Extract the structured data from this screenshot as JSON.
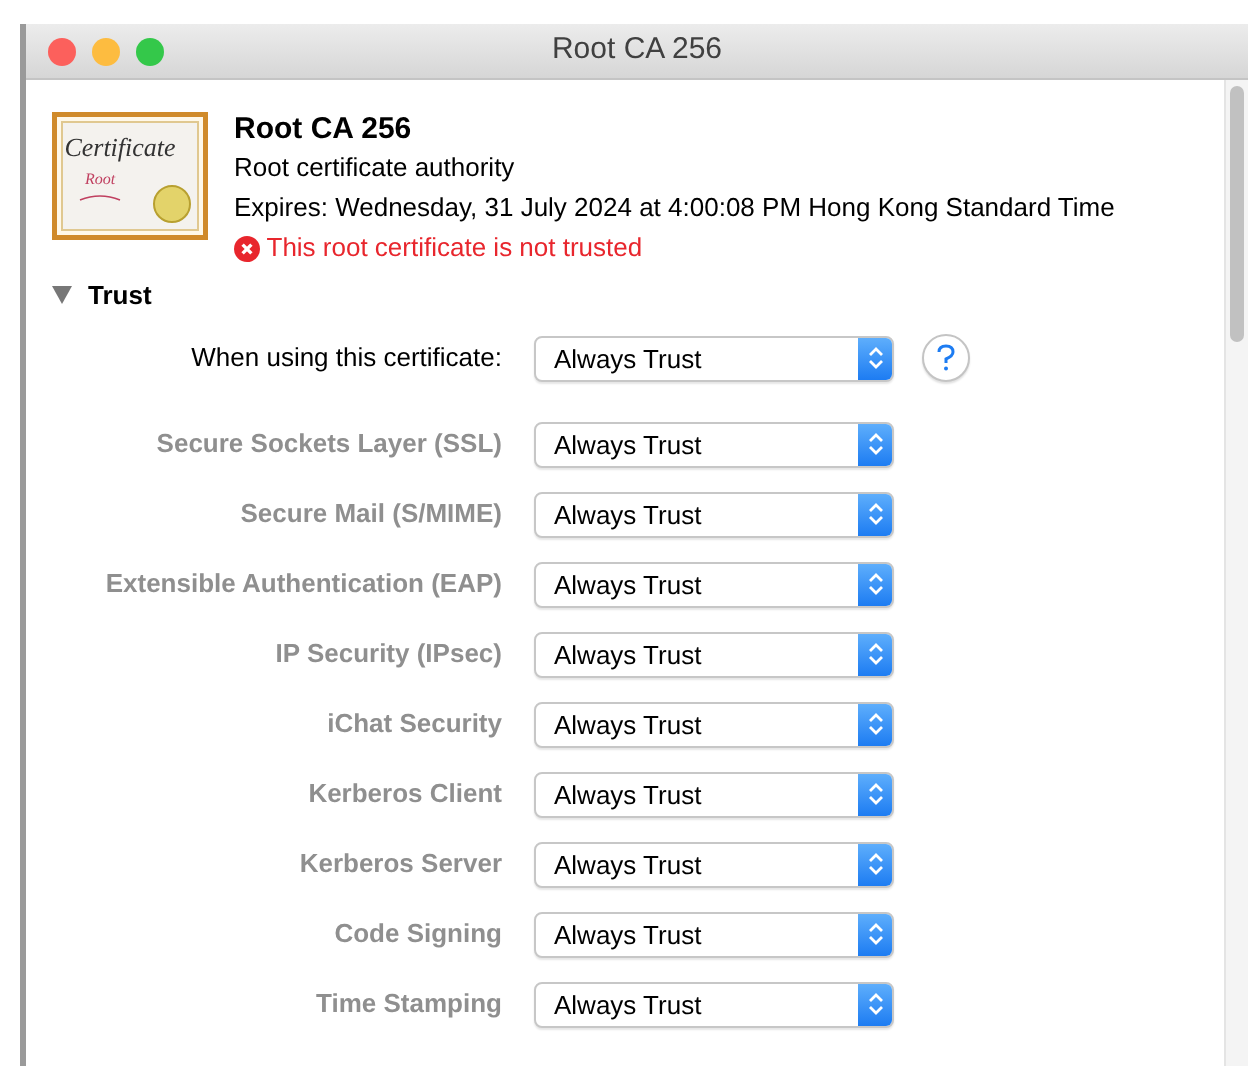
{
  "window": {
    "title": "Root CA 256"
  },
  "certificate": {
    "icon_title": "Certificate",
    "icon_subtitle": "Root",
    "name": "Root CA 256",
    "type": "Root certificate authority",
    "expires": "Expires: Wednesday, 31 July 2024 at 4:00:08 PM Hong Kong Standard Time",
    "status": "This root certificate is not trusted",
    "trusted": false
  },
  "trust": {
    "title": "Trust",
    "expanded": true,
    "main": {
      "label": "When using this certificate:",
      "value": "Always Trust"
    },
    "rows": [
      {
        "label": "Secure Sockets Layer (SSL)",
        "value": "Always Trust",
        "disabled": true
      },
      {
        "label": "Secure Mail (S/MIME)",
        "value": "Always Trust",
        "disabled": true
      },
      {
        "label": "Extensible Authentication (EAP)",
        "value": "Always Trust",
        "disabled": true
      },
      {
        "label": "IP Security (IPsec)",
        "value": "Always Trust",
        "disabled": true
      },
      {
        "label": "iChat Security",
        "value": "Always Trust",
        "disabled": true
      },
      {
        "label": "Kerberos Client",
        "value": "Always Trust",
        "disabled": true
      },
      {
        "label": "Kerberos Server",
        "value": "Always Trust",
        "disabled": true
      },
      {
        "label": "Code Signing",
        "value": "Always Trust",
        "disabled": true
      },
      {
        "label": "Time Stamping",
        "value": "Always Trust",
        "disabled": true
      }
    ]
  }
}
